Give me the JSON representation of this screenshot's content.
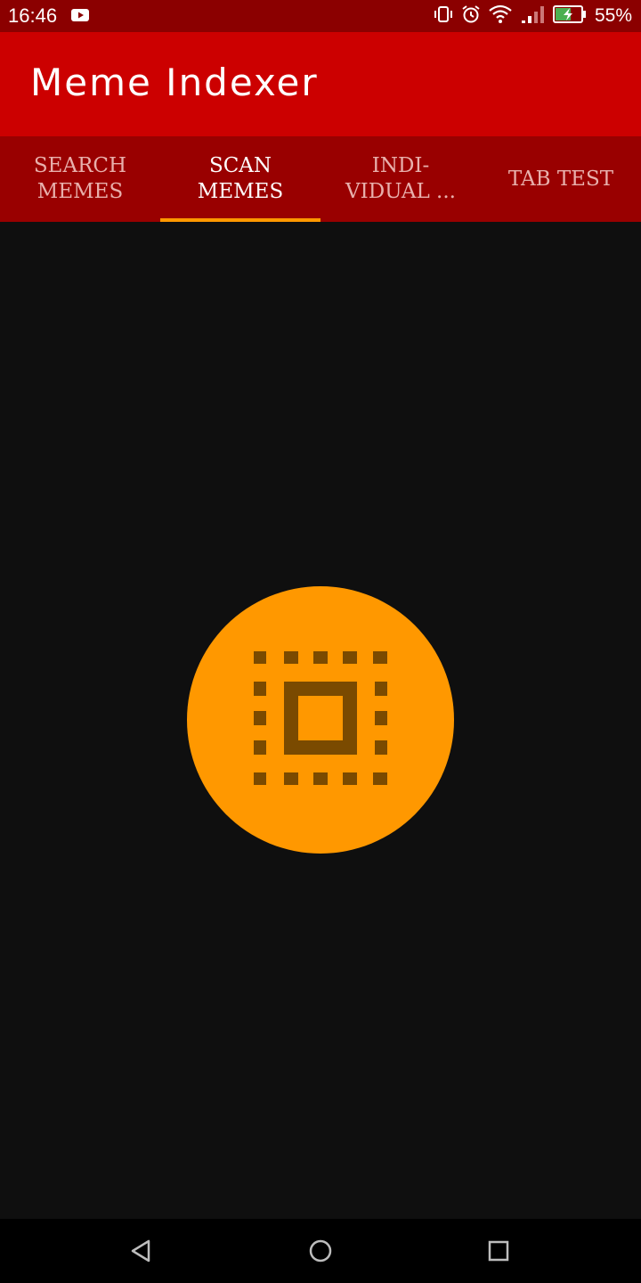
{
  "status_bar": {
    "time": "16:46",
    "battery_percent": "55%",
    "icons": [
      "youtube-icon",
      "vibrate-icon",
      "alarm-icon",
      "wifi-icon",
      "signal-icon",
      "battery-charging-icon"
    ]
  },
  "app_bar": {
    "title": "Meme Indexer"
  },
  "tabs": [
    {
      "label": "SEARCH\nMEMES",
      "active": false
    },
    {
      "label": "SCAN\nMEMES",
      "active": true
    },
    {
      "label": "INDI-\nVIDUAL ...",
      "active": false
    },
    {
      "label": "TAB TEST",
      "active": false
    }
  ],
  "scan_button": {
    "icon": "chip-icon"
  },
  "nav_bar": {
    "buttons": [
      "back-icon",
      "home-icon",
      "recents-icon"
    ]
  },
  "colors": {
    "status_bar": "#8b0000",
    "app_bar": "#cc0000",
    "tab_bar": "#990000",
    "accent": "#ff9800",
    "background": "#0f0f0f"
  }
}
